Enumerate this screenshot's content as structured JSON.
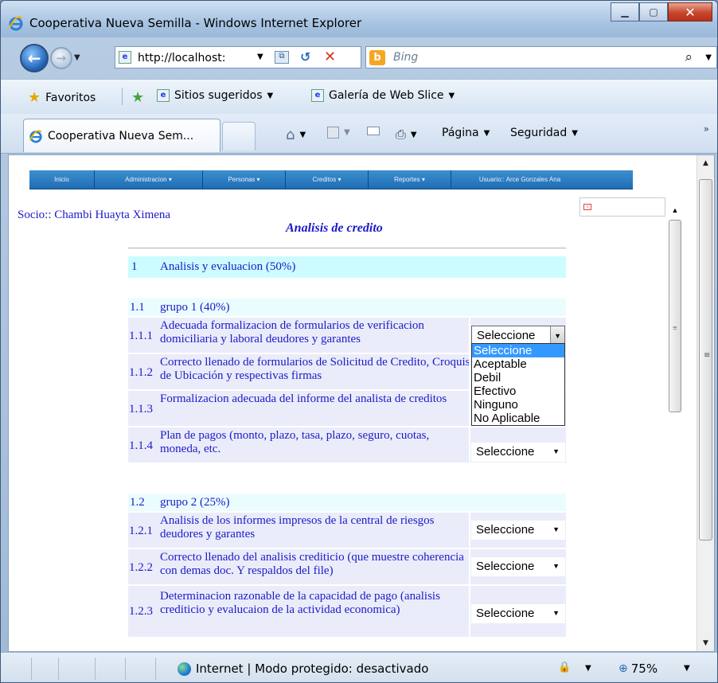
{
  "window": {
    "title": "Cooperativa Nueva Semilla - Windows Internet Explorer"
  },
  "address": {
    "url": "http://localhost:",
    "search_placeholder": "Bing"
  },
  "favorites": {
    "label": "Favoritos",
    "suggested": "Sitios sugeridos",
    "webslice": "Galería de Web Slice"
  },
  "tab": {
    "title": "Cooperativa Nueva Sem..."
  },
  "commands": {
    "page": "Página",
    "security": "Seguridad"
  },
  "menu": {
    "items": [
      "Inicio",
      "Administracion",
      "Personas",
      "Creditos",
      "Reportes",
      "Usuario:: Arce Gonzales Ana"
    ]
  },
  "page": {
    "socio": "Socio:: Chambi Huayta Ximena",
    "title": "Analisis de credito"
  },
  "section1": {
    "num": "1",
    "label": "Analisis y evaluacion (50%)"
  },
  "group1": {
    "num": "1.1",
    "label": "grupo 1 (40%)"
  },
  "group1_items": [
    {
      "num": "1.1.1",
      "label": "Adecuada formalizacion de formularios de verificacion domiciliaria y laboral deudores y garantes",
      "value": "Seleccione"
    },
    {
      "num": "1.1.2",
      "label": "Correcto llenado de formularios de Solicitud de Credito, Croquis de Ubicación y respectivas firmas"
    },
    {
      "num": "1.1.3",
      "label": "Formalizacion adecuada del informe del analista de creditos"
    },
    {
      "num": "1.1.4",
      "label": "Plan de pagos (monto, plazo, tasa, plazo, seguro, cuotas, moneda, etc.",
      "value": "Seleccione"
    }
  ],
  "group2": {
    "num": "1.2",
    "label": "grupo 2 (25%)"
  },
  "group2_items": [
    {
      "num": "1.2.1",
      "label": "Analisis de los informes impresos de la central de riesgos deudores y garantes",
      "value": "Seleccione"
    },
    {
      "num": "1.2.2",
      "label": "Correcto llenado del analisis crediticio (que muestre coherencia con demas doc. Y respaldos del file)",
      "value": "Seleccione"
    },
    {
      "num": "1.2.3",
      "label": "Determinacion razonable de la capacidad de pago (analisis crediticio y evalucaion de la actividad economica)",
      "value": "Seleccione"
    }
  ],
  "dropdown_options": [
    "Seleccione",
    "Aceptable",
    "Debil",
    "Efectivo",
    "Ninguno",
    "No Aplicable"
  ],
  "status": {
    "zone": "Internet | Modo protegido: desactivado",
    "zoom": "75%"
  },
  "colors": {
    "link_text": "#1a1ac8",
    "section_bg": "#ccfcff",
    "item_bg": "#ebecfa",
    "menu_bg": "#1f6db4",
    "highlight": "#3399ff"
  }
}
